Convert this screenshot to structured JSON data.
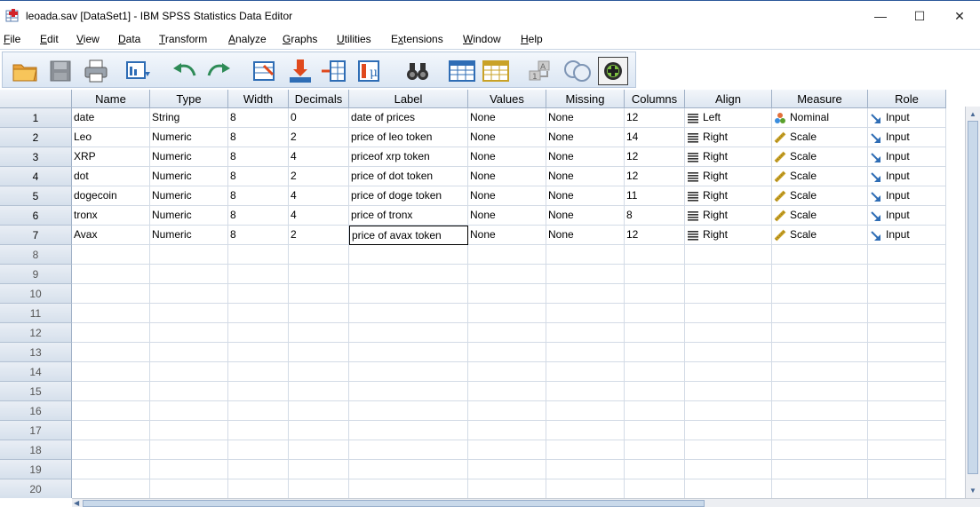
{
  "window": {
    "title": "leoada.sav [DataSet1] - IBM SPSS Statistics Data Editor",
    "minimize": "—",
    "maximize": "☐",
    "close": "✕"
  },
  "menu": [
    {
      "label": "File",
      "u": "F",
      "rest": "ile"
    },
    {
      "label": "Edit",
      "u": "E",
      "rest": "dit"
    },
    {
      "label": "View",
      "u": "V",
      "rest": "iew"
    },
    {
      "label": "Data",
      "u": "D",
      "rest": "ata"
    },
    {
      "label": "Transform",
      "u": "T",
      "rest": "ransform"
    },
    {
      "label": "Analyze",
      "u": "A",
      "rest": "nalyze"
    },
    {
      "label": "Graphs",
      "u": "G",
      "rest": "raphs"
    },
    {
      "label": "Utilities",
      "u": "U",
      "rest": "tilities"
    },
    {
      "label": "Extensions",
      "u": "x",
      "pre": "E",
      "rest": "tensions"
    },
    {
      "label": "Window",
      "u": "W",
      "rest": "indow"
    },
    {
      "label": "Help",
      "u": "H",
      "rest": "elp"
    }
  ],
  "toolbar": [
    "open-folder-icon",
    "save-icon",
    "print-icon",
    "dialog-recall-icon",
    "undo-icon",
    "redo-icon",
    "goto-case-icon",
    "goto-variable-icon",
    "variables-icon",
    "run-descriptives-icon",
    "find-icon",
    "insert-cases-icon",
    "insert-variable-icon",
    "split-file-icon",
    "value-labels-icon",
    "use-variable-sets-icon"
  ],
  "columns": [
    "Name",
    "Type",
    "Width",
    "Decimals",
    "Label",
    "Values",
    "Missing",
    "Columns",
    "Align",
    "Measure",
    "Role"
  ],
  "rows": [
    {
      "num": "1",
      "name": "date",
      "type": "String",
      "width": "8",
      "decimals": "0",
      "label": "date of prices",
      "values": "None",
      "missing": "None",
      "columns": "12",
      "align": "Left",
      "measure": "Nominal",
      "role": "Input"
    },
    {
      "num": "2",
      "name": "Leo",
      "type": "Numeric",
      "width": "8",
      "decimals": "2",
      "label": "price of leo token",
      "values": "None",
      "missing": "None",
      "columns": "14",
      "align": "Right",
      "measure": "Scale",
      "role": "Input"
    },
    {
      "num": "3",
      "name": "XRP",
      "type": "Numeric",
      "width": "8",
      "decimals": "4",
      "label": "priceof xrp token",
      "values": "None",
      "missing": "None",
      "columns": "12",
      "align": "Right",
      "measure": "Scale",
      "role": "Input"
    },
    {
      "num": "4",
      "name": "dot",
      "type": "Numeric",
      "width": "8",
      "decimals": "2",
      "label": "price of dot token",
      "values": "None",
      "missing": "None",
      "columns": "12",
      "align": "Right",
      "measure": "Scale",
      "role": "Input"
    },
    {
      "num": "5",
      "name": "dogecoin",
      "type": "Numeric",
      "width": "8",
      "decimals": "4",
      "label": "price of doge token",
      "values": "None",
      "missing": "None",
      "columns": "11",
      "align": "Right",
      "measure": "Scale",
      "role": "Input"
    },
    {
      "num": "6",
      "name": "tronx",
      "type": "Numeric",
      "width": "8",
      "decimals": "4",
      "label": "price of tronx",
      "values": "None",
      "missing": "None",
      "columns": "8",
      "align": "Right",
      "measure": "Scale",
      "role": "Input"
    },
    {
      "num": "7",
      "name": "Avax",
      "type": "Numeric",
      "width": "8",
      "decimals": "2",
      "label": "price of avax token",
      "values": "None",
      "missing": "None",
      "columns": "12",
      "align": "Right",
      "measure": "Scale",
      "role": "Input"
    }
  ],
  "empty_rows": [
    "8",
    "9",
    "10",
    "11",
    "12",
    "13",
    "14",
    "15",
    "16",
    "17",
    "18",
    "19",
    "20"
  ],
  "selected_cell": {
    "row": 7,
    "column": "Label"
  },
  "colors": {
    "accent": "#2b579a",
    "header": "#dde6f1",
    "grid_line": "#d3dbe6"
  }
}
